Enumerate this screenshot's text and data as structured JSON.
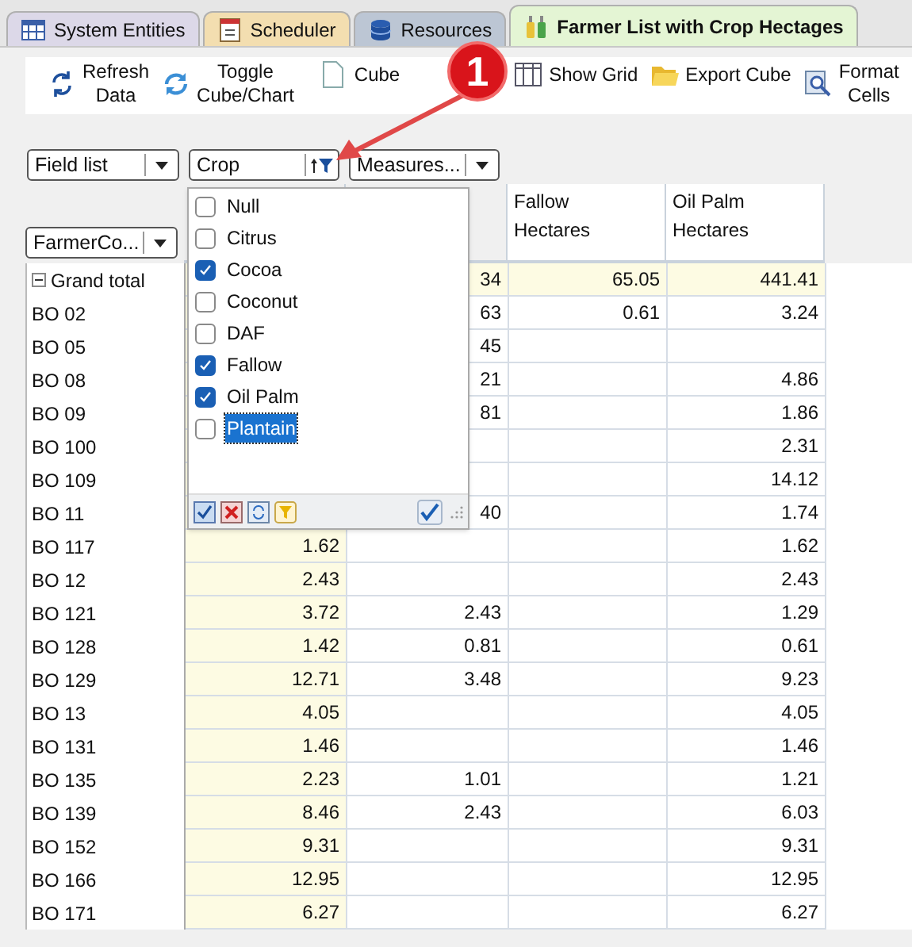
{
  "tabs": [
    {
      "label": "System Entities",
      "kind": "grid",
      "selected": false
    },
    {
      "label": "Scheduler",
      "kind": "calendar",
      "selected": false
    },
    {
      "label": "Resources",
      "kind": "database",
      "selected": false
    },
    {
      "label": "Farmer List with Crop Hectages",
      "kind": "bottles",
      "selected": true
    }
  ],
  "toolbar": [
    {
      "kind": "refresh",
      "lines": [
        "Refresh",
        "Data"
      ]
    },
    {
      "kind": "toggle",
      "lines": [
        "Toggle",
        "Cube/Chart"
      ]
    },
    {
      "kind": "page",
      "lines": [
        "Cube"
      ]
    },
    {
      "kind": "grid",
      "lines": [
        "Show Grid"
      ]
    },
    {
      "kind": "folder",
      "lines": [
        "Export Cube"
      ]
    },
    {
      "kind": "format",
      "lines": [
        "Format",
        "Cells"
      ]
    }
  ],
  "annotation": {
    "label": "1"
  },
  "filter_fields": [
    {
      "label": "Field list",
      "kind": "dropdown"
    },
    {
      "label": "Crop",
      "kind": "filter"
    },
    {
      "label": "Measures...",
      "kind": "dropdown"
    }
  ],
  "row_field": {
    "label": "FarmerCo..."
  },
  "filter_popup": {
    "items": [
      {
        "label": "Null",
        "checked": false,
        "selected": false
      },
      {
        "label": "Citrus",
        "checked": false,
        "selected": false
      },
      {
        "label": "Cocoa",
        "checked": true,
        "selected": false
      },
      {
        "label": "Coconut",
        "checked": false,
        "selected": false
      },
      {
        "label": "DAF",
        "checked": false,
        "selected": false
      },
      {
        "label": "Fallow",
        "checked": true,
        "selected": false
      },
      {
        "label": "Oil Palm",
        "checked": true,
        "selected": false
      },
      {
        "label": "Plantain",
        "checked": false,
        "selected": true
      }
    ]
  },
  "table": {
    "columns": [
      null,
      null,
      {
        "lines": [
          "Fallow",
          "Hectares"
        ]
      },
      {
        "lines": [
          "Oil Palm",
          "Hectares"
        ]
      }
    ],
    "rows": [
      {
        "label": "Grand total",
        "kind": "total",
        "cells": [
          null,
          "34",
          "65.05",
          "441.41"
        ]
      },
      {
        "label": "BO 02",
        "kind": "item",
        "cells": [
          null,
          "63",
          "0.61",
          "3.24"
        ]
      },
      {
        "label": "BO 05",
        "kind": "item",
        "cells": [
          null,
          "45",
          null,
          null
        ]
      },
      {
        "label": "BO 08",
        "kind": "item",
        "cells": [
          null,
          "21",
          null,
          "4.86"
        ]
      },
      {
        "label": "BO 09",
        "kind": "item",
        "cells": [
          null,
          "81",
          null,
          "1.86"
        ]
      },
      {
        "label": "BO 100",
        "kind": "item",
        "cells": [
          null,
          null,
          null,
          "2.31"
        ]
      },
      {
        "label": "BO 109",
        "kind": "item",
        "cells": [
          null,
          null,
          null,
          "14.12"
        ]
      },
      {
        "label": "BO 11",
        "kind": "item",
        "cells": [
          null,
          "40",
          null,
          "1.74"
        ]
      },
      {
        "label": "BO 117",
        "kind": "item",
        "cells": [
          "1.62",
          null,
          null,
          "1.62"
        ]
      },
      {
        "label": "BO 12",
        "kind": "item",
        "cells": [
          "2.43",
          null,
          null,
          "2.43"
        ]
      },
      {
        "label": "BO 121",
        "kind": "item",
        "cells": [
          "3.72",
          "2.43",
          null,
          "1.29"
        ]
      },
      {
        "label": "BO 128",
        "kind": "item",
        "cells": [
          "1.42",
          "0.81",
          null,
          "0.61"
        ]
      },
      {
        "label": "BO 129",
        "kind": "item",
        "cells": [
          "12.71",
          "3.48",
          null,
          "9.23"
        ]
      },
      {
        "label": "BO 13",
        "kind": "item",
        "cells": [
          "4.05",
          null,
          null,
          "4.05"
        ]
      },
      {
        "label": "BO 131",
        "kind": "item",
        "cells": [
          "1.46",
          null,
          null,
          "1.46"
        ]
      },
      {
        "label": "BO 135",
        "kind": "item",
        "cells": [
          "2.23",
          "1.01",
          null,
          "1.21"
        ]
      },
      {
        "label": "BO 139",
        "kind": "item",
        "cells": [
          "8.46",
          "2.43",
          null,
          "6.03"
        ]
      },
      {
        "label": "BO 152",
        "kind": "item",
        "cells": [
          "9.31",
          null,
          null,
          "9.31"
        ]
      },
      {
        "label": "BO 166",
        "kind": "item",
        "cells": [
          "12.95",
          null,
          null,
          "12.95"
        ]
      },
      {
        "label": "BO 171",
        "kind": "item",
        "cells": [
          "6.27",
          null,
          null,
          "6.27"
        ]
      }
    ]
  }
}
